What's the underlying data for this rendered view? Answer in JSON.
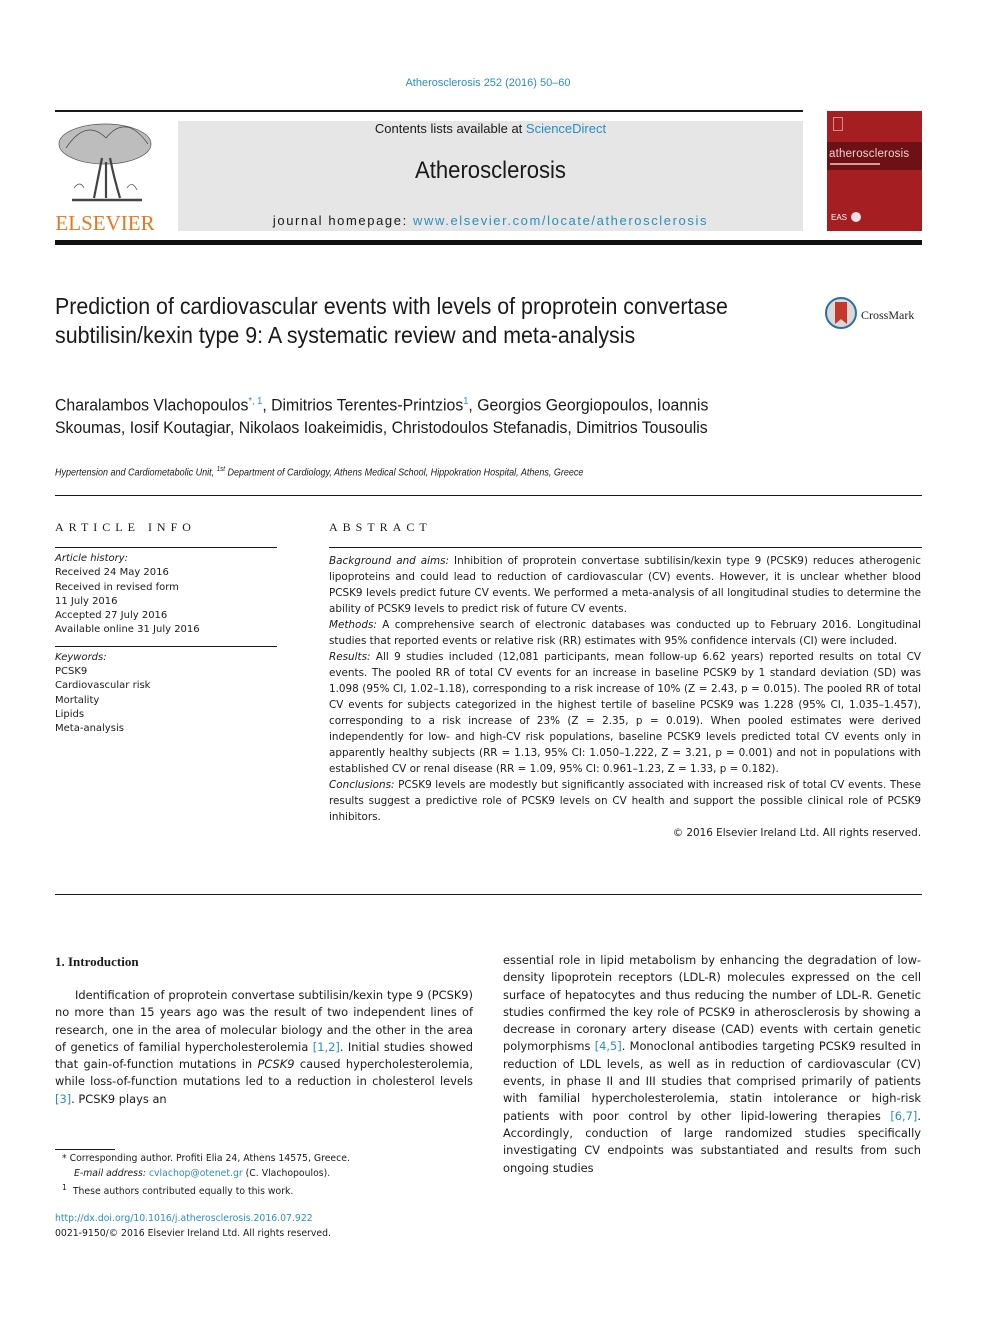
{
  "header": {
    "journal_ref": "Atherosclerosis 252 (2016) 50–60",
    "contents_prefix": "Contents lists available at ",
    "contents_link": "ScienceDirect",
    "journal_title": "Atherosclerosis",
    "homepage_prefix": "journal homepage: ",
    "homepage_link": "www.elsevier.com/locate/atherosclerosis",
    "publisher_logo_text": "ELSEVIER",
    "cover_title": "atherosclerosis",
    "cover_footer": "EAS",
    "colors": {
      "link": "#2a8fbd",
      "elsevier_orange": "#e87722",
      "cover_red": "#a51e22",
      "masthead_gray": "#e6e6e6"
    }
  },
  "article": {
    "title": "Prediction of cardiovascular events with levels of proprotein convertase subtilisin/kexin type 9: A systematic review and meta-analysis",
    "crossmark_label": "CrossMark",
    "authors": [
      {
        "name": "Charalambos Vlachopoulos",
        "sup": "*, 1"
      },
      {
        "name": "Dimitrios Terentes-Printzios",
        "sup": "1"
      },
      {
        "name": "Georgios Georgiopoulos",
        "sup": ""
      },
      {
        "name": "Ioannis Skoumas",
        "sup": ""
      },
      {
        "name": "Iosif Koutagiar",
        "sup": ""
      },
      {
        "name": "Nikolaos Ioakeimidis",
        "sup": ""
      },
      {
        "name": "Christodoulos Stefanadis",
        "sup": ""
      },
      {
        "name": "Dimitrios Tousoulis",
        "sup": ""
      }
    ],
    "affiliation_pre": "Hypertension and Cardiometabolic Unit, ",
    "affiliation_sup": "1st",
    "affiliation_post": " Department of Cardiology, Athens Medical School, Hippokration Hospital, Athens, Greece"
  },
  "article_info": {
    "heading": "ARTICLE INFO",
    "history_label": "Article history:",
    "history": [
      "Received 24 May 2016",
      "Received in revised form",
      "11 July 2016",
      "Accepted 27 July 2016",
      "Available online 31 July 2016"
    ],
    "keywords_label": "Keywords:",
    "keywords": [
      "PCSK9",
      "Cardiovascular risk",
      "Mortality",
      "Lipids",
      "Meta-analysis"
    ]
  },
  "abstract": {
    "heading": "ABSTRACT",
    "sections": [
      {
        "label": "Background and aims:",
        "text": " Inhibition of proprotein convertase subtilisin/kexin type 9 (PCSK9) reduces atherogenic lipoproteins and could lead to reduction of cardiovascular (CV) events. However, it is unclear whether blood PCSK9 levels predict future CV events. We performed a meta-analysis of all longitudinal studies to determine the ability of PCSK9 levels to predict risk of future CV events."
      },
      {
        "label": "Methods:",
        "text": " A comprehensive search of electronic databases was conducted up to February 2016. Longi­tudinal studies that reported events or relative risk (RR) estimates with 95% confidence intervals (CI) were included."
      },
      {
        "label": "Results:",
        "text": " All 9 studies included (12,081 participants, mean follow-up 6.62 years) reported results on total CV events. The pooled RR of total CV events for an increase in baseline PCSK9 by 1 standard deviation (SD) was 1.098 (95% CI, 1.02–1.18), corresponding to a risk increase of 10% (Z = 2.43, p = 0.015). The pooled RR of total CV events for subjects categorized in the highest tertile of baseline PCSK9 was 1.228 (95% CI, 1.035–1.457), corresponding to a risk increase of 23% (Z = 2.35, p = 0.019). When pooled esti­mates were derived independently for low- and high-CV risk populations, baseline PCSK9 levels pre­dicted total CV events only in apparently healthy subjects (RR = 1.13, 95% CI: 1.050–1.222, Z = 3.21, p = 0.001) and not in populations with established CV or renal disease (RR = 1.09, 95% CI: 0.961–1.23, Z = 1.33, p = 0.182)."
      },
      {
        "label": "Conclusions:",
        "text": " PCSK9 levels are modestly but significantly associated with increased risk of total CV events. These results suggest a predictive role of PCSK9 levels on CV health and support the possible clinical role of PCSK9 inhibitors."
      }
    ],
    "copyright": "© 2016 Elsevier Ireland Ltd. All rights reserved."
  },
  "introduction": {
    "heading": "1.  Introduction",
    "left": {
      "t1": "Identification of proprotein convertase subtilisin/kexin type 9 (PCSK9) no more than 15 years ago was the result of two inde­pendent lines of research, one in the area of molecular biology and the other in the area of genetics of familial hypercholesterolemia ",
      "ref1": "[1,2]",
      "t2": ". Initial studies showed that gain-of-function mutations in ",
      "gene": "PCSK9",
      "t3": " caused hypercholesterolemia, while loss-of-function muta­tions led to a reduction in cholesterol levels ",
      "ref2": "[3]",
      "t4": ". PCSK9 plays an"
    },
    "right": {
      "t1": "essential role in lipid metabolism by enhancing the degradation of low-density lipoprotein receptors (LDL-R) molecules expressed on the cell surface of hepatocytes and thus reducing the number of LDL-R. Genetic studies confirmed the key role of PCSK9 in athero­sclerosis by showing a decrease in coronary artery disease (CAD) events with certain genetic polymorphisms ",
      "ref1": "[4,5]",
      "t2": ". Monoclonal an­tibodies targeting PCSK9 resulted in reduction of LDL levels, as well as in reduction of cardiovascular (CV) events, in phase II and III studies that comprised primarily of patients with familial hyper­cholesterolemia, statin intolerance or high-risk patients with poor control by other lipid-lowering therapies ",
      "ref2": "[6,7]",
      "t3": ". Accordingly, con­duction of large randomized studies specifically investigating CV endpoints was substantiated and results from such ongoing studies"
    }
  },
  "footnotes": {
    "corresponding": "* Corresponding author. Profiti Elia 24, Athens 14575, Greece.",
    "email_label": "E-mail address:",
    "email": "cvlachop@otenet.gr",
    "email_suffix": " (C. Vlachopoulos).",
    "equal_sup": "1",
    "equal_text": "These authors contributed equally to this work.",
    "doi": "http://dx.doi.org/10.1016/j.atherosclerosis.2016.07.922",
    "issn": "0021-9150/© 2016 Elsevier Ireland Ltd. All rights reserved."
  }
}
